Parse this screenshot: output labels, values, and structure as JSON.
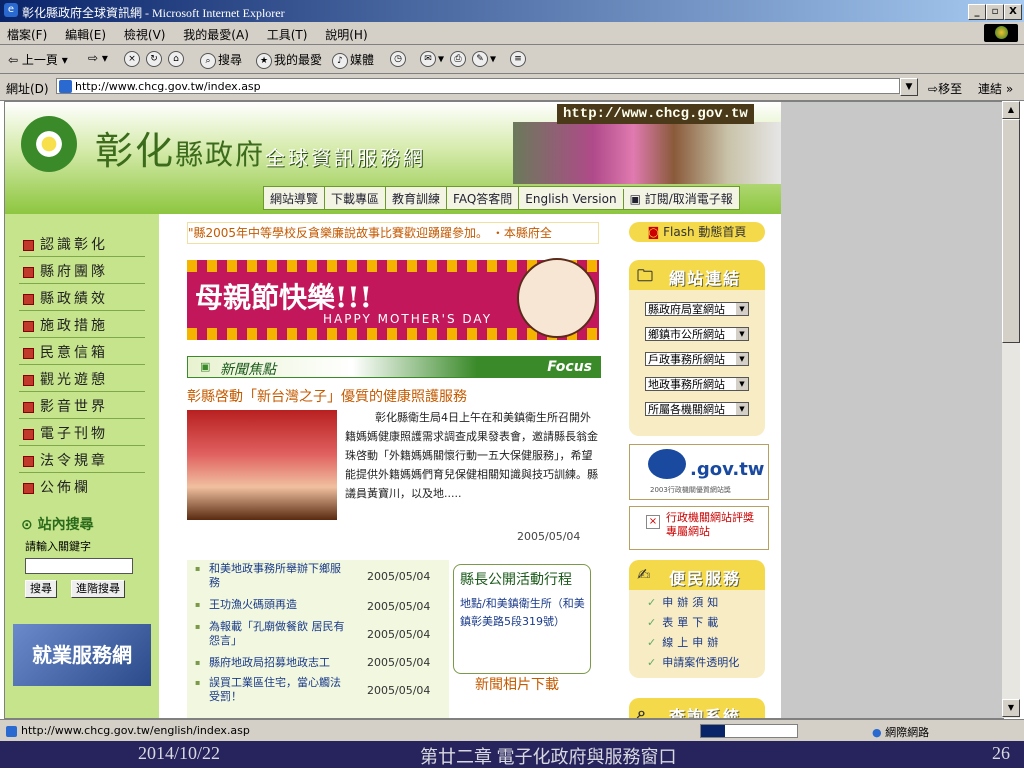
{
  "window": {
    "title": "彰化縣政府全球資訊網 - Microsoft Internet Explorer",
    "controls": {
      "minimize": "_",
      "maximize": "▫",
      "close": "X"
    }
  },
  "menu": [
    "檔案(F)",
    "編輯(E)",
    "檢視(V)",
    "我的最愛(A)",
    "工具(T)",
    "說明(H)"
  ],
  "toolbar": {
    "back": "上一頁",
    "search": "搜尋",
    "favorites": "我的最愛",
    "media": "媒體"
  },
  "address": {
    "label": "網址(D)",
    "url": "http://www.chcg.gov.tw/index.asp",
    "go": "移至",
    "links": "連結 »"
  },
  "site": {
    "url_banner": "http://www.chcg.gov.tw",
    "title_big": "彰化",
    "title_mid": "縣政府",
    "subtitle": "全球資訊服務網",
    "top_nav": [
      "網站導覽",
      "下載專區",
      "教育訓練",
      "FAQ答客問",
      "English Version",
      "訂閱/取消電子報"
    ],
    "left_menu": [
      "認識彰化",
      "縣府團隊",
      "縣政績效",
      "施政措施",
      "民意信箱",
      "觀光遊憩",
      "影音世界",
      "電子刊物",
      "法令規章",
      "公佈欄"
    ],
    "search": {
      "title": "站內搜尋",
      "hint": "請輸入關鍵字",
      "button": "搜尋",
      "advanced": "進階搜尋"
    },
    "job_banner": "就業服務網",
    "ticker": "\"縣2005年中等學校反貪樂廉說故事比賽歡迎踴躍參加。 ・本縣府全",
    "mothers_day": {
      "title": "母親節快樂!!!",
      "subtitle": "HAPPY MOTHER'S DAY"
    },
    "news_header": {
      "title": "新聞焦點",
      "focus": "Focus"
    },
    "headline": "彰縣啓動「新台灣之子」優質的健康照護服務",
    "news_body": "彰化縣衛生局4日上午在和美鎮衛生所召開外籍媽媽健康照護需求調查成果發表會，邀請縣長翁金珠啓動「外籍媽媽關懷行動一五大保健服務」，希望能提供外籍媽媽們育兒保健相關知識與技巧訓練。縣議員黃寶川，以及地.....",
    "news_date": "2005/05/04",
    "news_list": [
      {
        "title": "和美地政事務所舉辦下鄉服務",
        "date": "2005/05/04"
      },
      {
        "title": "王功漁火碼頭再造",
        "date": "2005/05/04"
      },
      {
        "title": "為報載「孔廟做餐飲 居民有怨言」",
        "date": "2005/05/04"
      },
      {
        "title": "縣府地政局招募地政志工",
        "date": "2005/05/04"
      },
      {
        "title": "誤買工業區住宅，當心觸法受罰！",
        "date": "2005/05/04"
      }
    ],
    "activity": {
      "title": "縣長公開活動行程",
      "body": "地點/和美鎮衛生所（和美鎮彰美路5段319號）"
    },
    "photo_download": "新聞相片下載",
    "flash": "Flash 動態首頁",
    "links_panel": {
      "title": "網站連結",
      "selects": [
        "縣政府局室網站",
        "鄉鎮市公所網站",
        "戶政事務所網站",
        "地政事務所網站",
        "所屬各機關網站"
      ]
    },
    "gov_badge": {
      "main": ".gov.tw",
      "sub": "2003行政機關優質網站獎"
    },
    "eval_box": "行政機關網站評獎專屬網站",
    "service_panel": {
      "title": "便民服務",
      "items": [
        "申辦須知",
        "表單下載",
        "線上申辦",
        "申請案件透明化"
      ]
    },
    "query_panel": {
      "title": "查詢系統"
    }
  },
  "status": {
    "url": "http://www.chcg.gov.tw/english/index.asp",
    "zone": "網際網路",
    "progress": 0.25
  },
  "footer": {
    "date": "2014/10/22",
    "title": "第廿二章 電子化政府與服務窗口",
    "page": "26"
  }
}
